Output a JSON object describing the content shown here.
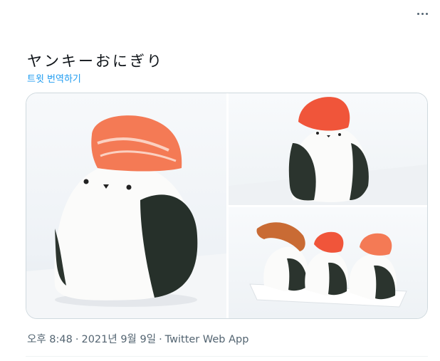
{
  "tweet": {
    "text": "ヤンキーおにぎり",
    "translate_label": "트윗 번역하기",
    "time": "오후 8:48",
    "separator": "·",
    "date": "2021년 9월 9일",
    "app": "Twitter Web App"
  },
  "menu": {
    "icon": "more-horizontal-icon"
  },
  "colors": {
    "link": "#1d9bf0",
    "meta": "#536471",
    "text": "#0f1419",
    "border": "#cfd9de"
  },
  "media": [
    {
      "subject": "onigiri-with-salmon-topping"
    },
    {
      "subject": "onigiri-with-salmon-topping"
    },
    {
      "subject": "three-onigiri-with-fried-shrimp-and-salmon"
    }
  ]
}
